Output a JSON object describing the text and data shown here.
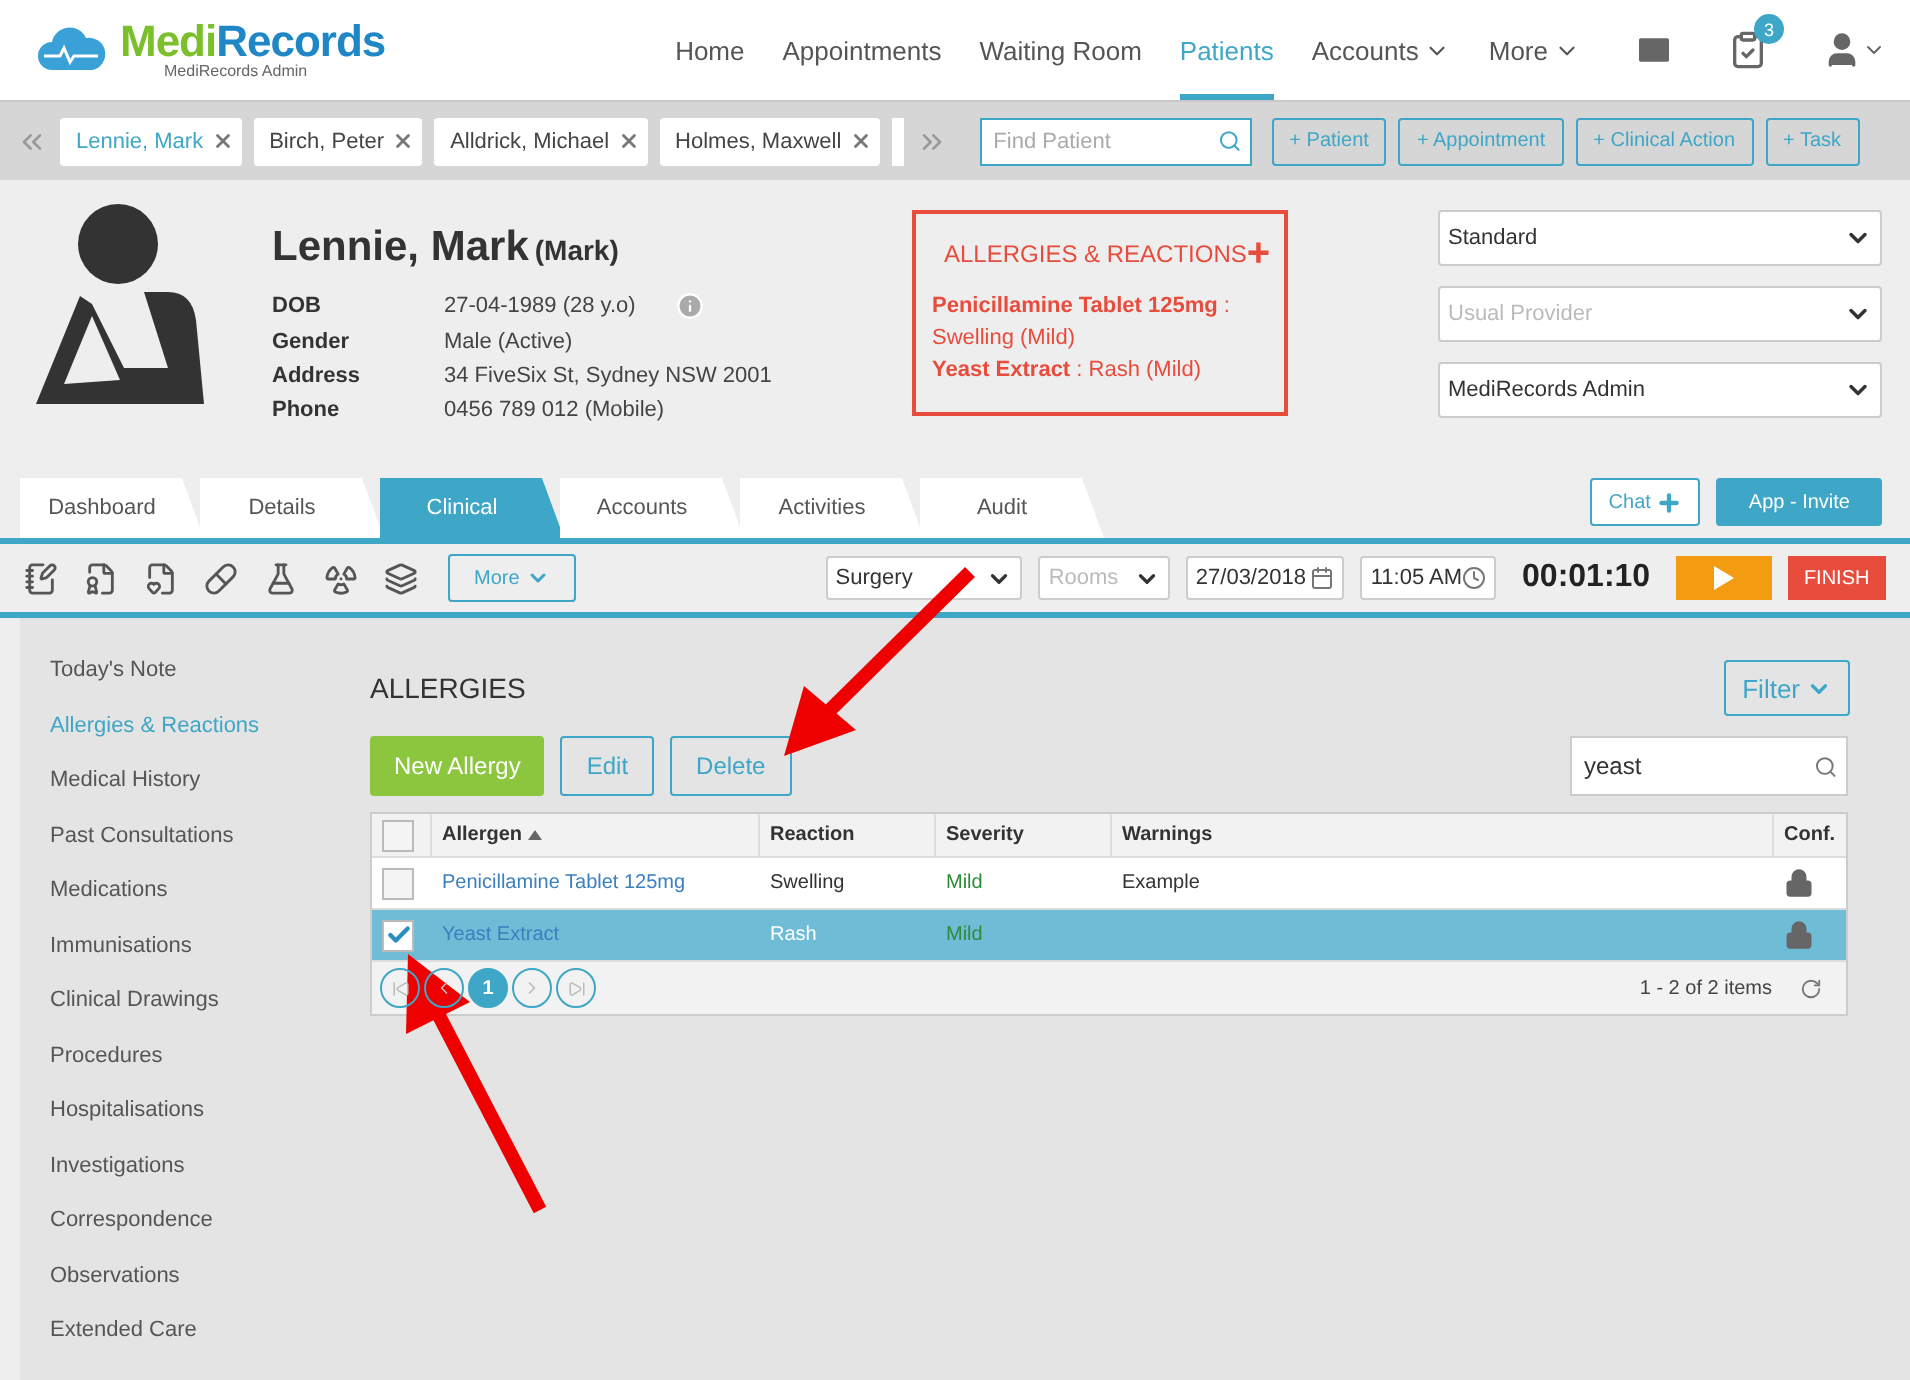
{
  "app": {
    "logo_main": "Medi",
    "logo_accent": "Records",
    "subtitle": "MediRecords Admin"
  },
  "nav": [
    {
      "label": "Home",
      "selected": false,
      "dropdown": false
    },
    {
      "label": "Appointments",
      "selected": false,
      "dropdown": false
    },
    {
      "label": "Waiting Room",
      "selected": false,
      "dropdown": false
    },
    {
      "label": "Patients",
      "selected": true,
      "dropdown": false
    },
    {
      "label": "Accounts",
      "selected": false,
      "dropdown": true
    },
    {
      "label": "More",
      "selected": false,
      "dropdown": true
    }
  ],
  "notification_count": "3",
  "patient_bar": {
    "chips": [
      {
        "name": "Lennie, Mark",
        "selected": true
      },
      {
        "name": "Birch, Peter",
        "selected": false
      },
      {
        "name": "Alldrick, Michael",
        "selected": false
      },
      {
        "name": "Holmes, Maxwell",
        "selected": false
      }
    ],
    "search": {
      "placeholder": "Find Patient"
    },
    "actions": [
      "+ Patient",
      "+ Appointment",
      "+ Clinical Action",
      "+ Task"
    ]
  },
  "patient": {
    "name": "Lennie, Mark",
    "preferred": "(Mark)",
    "details": [
      {
        "label": "DOB",
        "value": "27-04-1989 (28 y.o)"
      },
      {
        "label": "Gender",
        "value": "Male (Active)"
      },
      {
        "label": "Address",
        "value": "34 FiveSix St, Sydney NSW 2001"
      },
      {
        "label": "Phone",
        "value": "0456 789 012 (Mobile)"
      }
    ]
  },
  "allergy_card": {
    "title": "ALLERGIES & REACTIONS",
    "add": "+",
    "items": [
      "**Penicillamine Tablet 125mg** : Swelling (Mild)",
      "**Yeast Extract** : Rash (Mild)"
    ]
  },
  "selects": [
    {
      "value": "Standard"
    },
    {
      "placeholder": "Usual Provider"
    },
    {
      "value": "MediRecords Admin"
    }
  ],
  "record_tabs": [
    {
      "label": "Dashboard",
      "selected": false
    },
    {
      "label": "Details",
      "selected": false
    },
    {
      "label": "Clinical",
      "selected": true
    },
    {
      "label": "Accounts",
      "selected": false
    },
    {
      "label": "Activities",
      "selected": false
    },
    {
      "label": "Audit",
      "selected": false
    }
  ],
  "chat_button": "Chat",
  "invite_button": "App - Invite",
  "toolbar": {
    "more": "More",
    "location": "Surgery",
    "room": {
      "placeholder": "Rooms"
    },
    "date": "27/03/2018",
    "time": "11:05 AM",
    "timer": "00:01:10",
    "finish": "FINISH"
  },
  "sidebar": [
    {
      "label": "Today's Note",
      "selected": false
    },
    {
      "label": "Allergies & Reactions",
      "selected": true
    },
    {
      "label": "Medical History",
      "selected": false
    },
    {
      "label": "Past Consultations",
      "selected": false
    },
    {
      "label": "Medications",
      "selected": false
    },
    {
      "label": "Immunisations",
      "selected": false
    },
    {
      "label": "Clinical Drawings",
      "selected": false
    },
    {
      "label": "Procedures",
      "selected": false
    },
    {
      "label": "Hospitalisations",
      "selected": false
    },
    {
      "label": "Investigations",
      "selected": false
    },
    {
      "label": "Correspondence",
      "selected": false
    },
    {
      "label": "Observations",
      "selected": false
    },
    {
      "label": "Extended Care",
      "selected": false
    }
  ],
  "allergies": {
    "title": "ALLERGIES",
    "filter": "Filter",
    "buttons": [
      {
        "label": "New Allergy",
        "kind": "primary"
      },
      {
        "label": "Edit",
        "kind": "outline"
      },
      {
        "label": "Delete",
        "kind": "outline"
      }
    ],
    "search": {
      "value": "yeast"
    },
    "table": {
      "all_checked": false,
      "columns": [
        "Allergen",
        "Reaction",
        "Severity",
        "Warnings",
        "Conf."
      ],
      "rows": [
        {
          "allergen": "Penicillamine Tablet 125mg",
          "reaction": "Swelling",
          "severity": "Mild",
          "warnings": "Example",
          "checked": false,
          "selected": false
        },
        {
          "allergen": "Yeast Extract",
          "reaction": "Rash",
          "severity": "Mild",
          "warnings": "",
          "checked": true,
          "selected": true
        }
      ]
    },
    "pager": {
      "page": "1",
      "summary": "1 - 2 of 2 items"
    }
  }
}
